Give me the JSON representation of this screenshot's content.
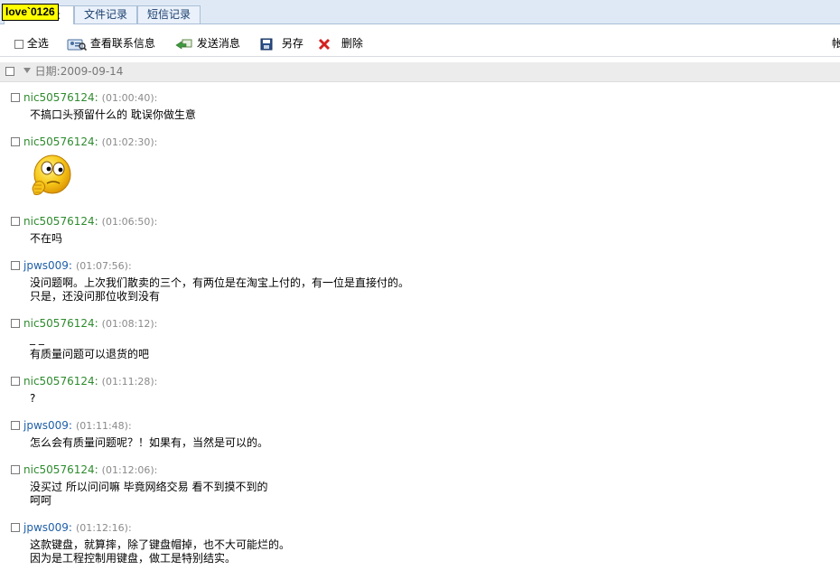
{
  "overlay_tag": "love`0126",
  "tabs": [
    {
      "label": "聊天记录",
      "active": true
    },
    {
      "label": "文件记录",
      "active": false
    },
    {
      "label": "短信记录",
      "active": false
    }
  ],
  "toolbar": {
    "select_all": "全选",
    "view_contact": "查看联系信息",
    "send_message": "发送消息",
    "save_as": "另存",
    "delete": "删除",
    "right_edge": "帐"
  },
  "date_label": "日期:2009-09-14",
  "messages": [
    {
      "sender": "nic50576124",
      "time": "(01:00:40):",
      "lines": [
        "不搞口头预留什么的 耽误你做生意"
      ]
    },
    {
      "sender": "nic50576124",
      "time": "(01:02:30):",
      "lines": [],
      "emoji": "thinking-face"
    },
    {
      "sender": "nic50576124",
      "time": "(01:06:50):",
      "lines": [
        "不在吗"
      ]
    },
    {
      "sender": "jpws009",
      "time": "(01:07:56):",
      "lines": [
        "没问题啊。上次我们散卖的三个，有两位是在淘宝上付的，有一位是直接付的。",
        "只是，还没问那位收到没有"
      ]
    },
    {
      "sender": "nic50576124",
      "time": "(01:08:12):",
      "lines": [
        "_ _",
        "有质量问题可以退货的吧"
      ]
    },
    {
      "sender": "nic50576124",
      "time": "(01:11:28):",
      "lines": [
        "?"
      ]
    },
    {
      "sender": "jpws009",
      "time": "(01:11:48):",
      "lines": [
        "怎么会有质量问题呢？！如果有，当然是可以的。"
      ]
    },
    {
      "sender": "nic50576124",
      "time": "(01:12:06):",
      "lines": [
        "没买过 所以问问嘛 毕竟网络交易 看不到摸不到的",
        "呵呵"
      ]
    },
    {
      "sender": "jpws009",
      "time": "(01:12:16):",
      "lines": [
        "这款键盘，就算摔，除了键盘帽掉，也不大可能烂的。",
        "因为是工程控制用键盘，做工是特别结实。"
      ]
    }
  ],
  "colors": {
    "buyer": "#2e8b2e",
    "seller": "#1f5fa8",
    "time": "#8a8a8a"
  }
}
